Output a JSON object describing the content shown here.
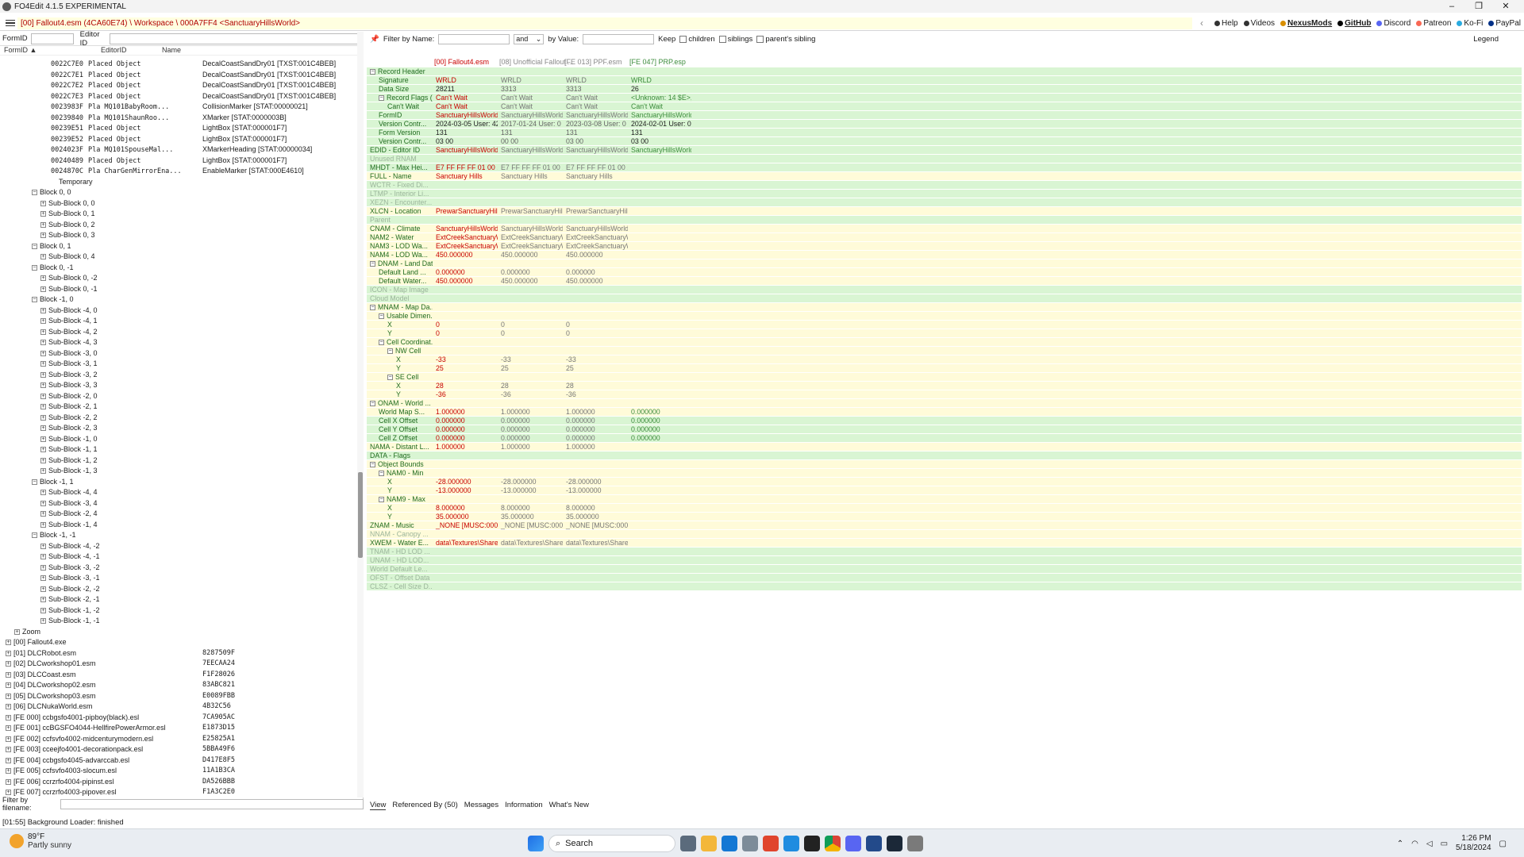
{
  "window": {
    "title": "FO4Edit 4.1.5 EXPERIMENTAL",
    "controls": [
      "–",
      "❐",
      "✕"
    ]
  },
  "menubar": {
    "path": "[00] Fallout4.esm (4CA60E74) \\ Workspace \\ 000A7FF4 <SanctuaryHillsWorld>",
    "back": "‹",
    "forward": "›",
    "links": [
      {
        "label": "Help",
        "color": "#333"
      },
      {
        "label": "Videos",
        "color": "#333"
      },
      {
        "label": "NexusMods",
        "color": "#d98f00",
        "bold": true
      },
      {
        "label": "GitHub",
        "color": "#000",
        "bold": true
      },
      {
        "label": "Discord",
        "color": "#5865f2"
      },
      {
        "label": "Patreon",
        "color": "#f96854"
      },
      {
        "label": "Ko-Fi",
        "color": "#29abe0"
      },
      {
        "label": "PayPal",
        "color": "#003087"
      }
    ]
  },
  "left": {
    "formid_label": "FormID",
    "editorid_label": "Editor ID",
    "col_formid": "FormID ▲",
    "col_editorid": "EditorID",
    "col_name": "Name",
    "filter_label": "Filter by filename:",
    "tree": [
      {
        "i": 64,
        "fid": "0022C7E0",
        "et": "Placed Object",
        "nm": "DecalCoastSandDry01 [TXST:001C4BEB]"
      },
      {
        "i": 64,
        "fid": "0022C7E1",
        "et": "Placed Object",
        "nm": "DecalCoastSandDry01 [TXST:001C4BEB]"
      },
      {
        "i": 64,
        "fid": "0022C7E2",
        "et": "Placed Object",
        "nm": "DecalCoastSandDry01 [TXST:001C4BEB]"
      },
      {
        "i": 64,
        "fid": "0022C7E3",
        "et": "Placed Object",
        "nm": "DecalCoastSandDry01 [TXST:001C4BEB]"
      },
      {
        "i": 64,
        "fid": "0023983F",
        "et": "Pla   MQ101BabyRoom...",
        "nm": "CollisionMarker [STAT:00000021]"
      },
      {
        "i": 64,
        "fid": "00239840",
        "et": "Pla   MQ101ShaunRoo...",
        "nm": "XMarker [STAT:0000003B]"
      },
      {
        "i": 64,
        "fid": "00239E51",
        "et": "Placed Object",
        "nm": "LightBox [STAT:000001F7]"
      },
      {
        "i": 64,
        "fid": "00239E52",
        "et": "Placed Object",
        "nm": "LightBox [STAT:000001F7]"
      },
      {
        "i": 64,
        "fid": "0024023F",
        "et": "Pla   MQ101SpouseMal...",
        "nm": "XMarkerHeading [STAT:00000034]"
      },
      {
        "i": 64,
        "fid": "00240489",
        "et": "Placed Object",
        "nm": "LightBox [STAT:000001F7]"
      },
      {
        "i": 64,
        "fid": "0024870C",
        "et": "Pla   CharGenMirrorEna...",
        "nm": "EnableMarker [STAT:000E4610]"
      },
      {
        "i": 64,
        "t": "Temporary"
      },
      {
        "i": 40,
        "t": "Block 0, 0",
        "e": "−"
      },
      {
        "i": 51,
        "t": "Sub-Block 0, 0",
        "e": "+"
      },
      {
        "i": 51,
        "t": "Sub-Block 0, 1",
        "e": "+"
      },
      {
        "i": 51,
        "t": "Sub-Block 0, 2",
        "e": "+"
      },
      {
        "i": 51,
        "t": "Sub-Block 0, 3",
        "e": "+"
      },
      {
        "i": 40,
        "t": "Block 0, 1",
        "e": "−"
      },
      {
        "i": 51,
        "t": "Sub-Block 0, 4",
        "e": "+"
      },
      {
        "i": 40,
        "t": "Block 0, -1",
        "e": "−"
      },
      {
        "i": 51,
        "t": "Sub-Block 0, -2",
        "e": "+"
      },
      {
        "i": 51,
        "t": "Sub-Block 0, -1",
        "e": "+"
      },
      {
        "i": 40,
        "t": "Block -1, 0",
        "e": "−"
      },
      {
        "i": 51,
        "t": "Sub-Block -4, 0",
        "e": "+"
      },
      {
        "i": 51,
        "t": "Sub-Block -4, 1",
        "e": "+"
      },
      {
        "i": 51,
        "t": "Sub-Block -4, 2",
        "e": "+"
      },
      {
        "i": 51,
        "t": "Sub-Block -4, 3",
        "e": "+"
      },
      {
        "i": 51,
        "t": "Sub-Block -3, 0",
        "e": "+"
      },
      {
        "i": 51,
        "t": "Sub-Block -3, 1",
        "e": "+"
      },
      {
        "i": 51,
        "t": "Sub-Block -3, 2",
        "e": "+"
      },
      {
        "i": 51,
        "t": "Sub-Block -3, 3",
        "e": "+"
      },
      {
        "i": 51,
        "t": "Sub-Block -2, 0",
        "e": "+"
      },
      {
        "i": 51,
        "t": "Sub-Block -2, 1",
        "e": "+"
      },
      {
        "i": 51,
        "t": "Sub-Block -2, 2",
        "e": "+"
      },
      {
        "i": 51,
        "t": "Sub-Block -2, 3",
        "e": "+"
      },
      {
        "i": 51,
        "t": "Sub-Block -1, 0",
        "e": "+"
      },
      {
        "i": 51,
        "t": "Sub-Block -1, 1",
        "e": "+"
      },
      {
        "i": 51,
        "t": "Sub-Block -1, 2",
        "e": "+"
      },
      {
        "i": 51,
        "t": "Sub-Block -1, 3",
        "e": "+"
      },
      {
        "i": 40,
        "t": "Block -1, 1",
        "e": "−"
      },
      {
        "i": 51,
        "t": "Sub-Block -4, 4",
        "e": "+"
      },
      {
        "i": 51,
        "t": "Sub-Block -3, 4",
        "e": "+"
      },
      {
        "i": 51,
        "t": "Sub-Block -2, 4",
        "e": "+"
      },
      {
        "i": 51,
        "t": "Sub-Block -1, 4",
        "e": "+"
      },
      {
        "i": 40,
        "t": "Block -1, -1",
        "e": "−"
      },
      {
        "i": 51,
        "t": "Sub-Block -4, -2",
        "e": "+"
      },
      {
        "i": 51,
        "t": "Sub-Block -4, -1",
        "e": "+"
      },
      {
        "i": 51,
        "t": "Sub-Block -3, -2",
        "e": "+"
      },
      {
        "i": 51,
        "t": "Sub-Block -3, -1",
        "e": "+"
      },
      {
        "i": 51,
        "t": "Sub-Block -2, -2",
        "e": "+"
      },
      {
        "i": 51,
        "t": "Sub-Block -2, -1",
        "e": "+"
      },
      {
        "i": 51,
        "t": "Sub-Block -1, -2",
        "e": "+"
      },
      {
        "i": 51,
        "t": "Sub-Block -1, -1",
        "e": "+"
      },
      {
        "i": 18,
        "t": "Zoom",
        "e": "+"
      },
      {
        "i": 7,
        "t": "[00] Fallout4.exe",
        "e": "+"
      },
      {
        "i": 7,
        "t": "[01] DLCRobot.esm",
        "e": "+",
        "hx": "8287509F"
      },
      {
        "i": 7,
        "t": "[02] DLCworkshop01.esm",
        "e": "+",
        "hx": "7EECAA24"
      },
      {
        "i": 7,
        "t": "[03] DLCCoast.esm",
        "e": "+",
        "hx": "F1F28026"
      },
      {
        "i": 7,
        "t": "[04] DLCworkshop02.esm",
        "e": "+",
        "hx": "83ABC821"
      },
      {
        "i": 7,
        "t": "[05] DLCworkshop03.esm",
        "e": "+",
        "hx": "E0089FBB"
      },
      {
        "i": 7,
        "t": "[06] DLCNukaWorld.esm",
        "e": "+",
        "hx": "4B32C56"
      },
      {
        "i": 7,
        "t": "[FE 000] ccbgsfo4001-pipboy(black).esl",
        "e": "+",
        "hx": "7CA905AC"
      },
      {
        "i": 7,
        "t": "[FE 001] ccBGSFO4044-HellfirePowerArmor.esl",
        "e": "+",
        "hx": "E1873D15"
      },
      {
        "i": 7,
        "t": "[FE 002] ccfsvfo4002-midcenturymodern.esl",
        "e": "+",
        "hx": "E25825A1"
      },
      {
        "i": 7,
        "t": "[FE 003] cceejfo4001-decorationpack.esl",
        "e": "+",
        "hx": "5BBA49F6"
      },
      {
        "i": 7,
        "t": "[FE 004] ccbgsfo4045-advarccab.esl",
        "e": "+",
        "hx": "D417E8F5"
      },
      {
        "i": 7,
        "t": "[FE 005] ccfsvfo4003-slocum.esl",
        "e": "+",
        "hx": "11A1B3CA"
      },
      {
        "i": 7,
        "t": "[FE 006] ccrzrfo4004-pipinst.esl",
        "e": "+",
        "hx": "DA526BBB"
      },
      {
        "i": 7,
        "t": "[FE 007] ccrzrfo4003-pipover.esl",
        "e": "+",
        "hx": "F1A3C2E0"
      }
    ]
  },
  "right": {
    "filter_name_label": "Filter by Name:",
    "and_label": "and",
    "by_value_label": "by Value:",
    "keep_label": "Keep",
    "children_label": "children",
    "siblings_label": "siblings",
    "parents_sibling_label": "parent's sibling",
    "legend_label": "Legend",
    "headers": [
      "[00] Fallout4.esm",
      "[08] Unofficial Fallout ...",
      "[FE 013] PPF.esm",
      "[FE 047] PRP.esp"
    ],
    "rows": [
      {
        "l": "Record Header",
        "ind": 0,
        "e": "−",
        "bg": "g",
        "v": []
      },
      {
        "l": "Signature",
        "ind": 1,
        "bg": "g",
        "v": [
          "WRLD",
          "WRLD",
          "WRLD",
          "WRLD"
        ]
      },
      {
        "l": "Data Size",
        "ind": 1,
        "bg": "g",
        "v": [
          "28211",
          "3313",
          "3313",
          "26"
        ],
        "k": [
          "#000",
          "#000",
          "#000",
          "#000"
        ]
      },
      {
        "l": "Record Flags (...",
        "ind": 1,
        "e": "−",
        "bg": "g",
        "v": [
          "Can't Wait",
          "Can't Wait",
          "Can't Wait",
          "<Unknown: 14 $E>, ..."
        ]
      },
      {
        "l": "Can't Wait",
        "ind": 2,
        "bg": "g",
        "v": [
          "Can't Wait",
          "Can't Wait",
          "Can't Wait",
          "Can't Wait"
        ]
      },
      {
        "l": "FormID",
        "ind": 1,
        "bg": "g",
        "v": [
          "SanctuaryHillsWorld ...",
          "SanctuaryHillsWorld ...",
          "SanctuaryHillsWorld ...",
          "SanctuaryHillsWorld ..."
        ]
      },
      {
        "l": "Version Contr...",
        "ind": 1,
        "bg": "g",
        "v": [
          "2024-03-05 User: 42...",
          "2017-01-24 User: 0 L...",
          "2023-03-08 User: 0 L...",
          "2024-02-01 User: 0 L..."
        ],
        "k": [
          "#000",
          "#000",
          "#000",
          "#000"
        ]
      },
      {
        "l": "Form Version",
        "ind": 1,
        "bg": "g",
        "v": [
          "131",
          "131",
          "131",
          "131"
        ],
        "k": [
          "#000",
          "#000",
          "#000",
          "#000"
        ]
      },
      {
        "l": "Version Contr...",
        "ind": 1,
        "bg": "g",
        "v": [
          "03 00",
          "00 00",
          "03 00",
          "03 00"
        ],
        "k": [
          "#000",
          "#000",
          "#000",
          "#000"
        ]
      },
      {
        "l": "EDID - Editor ID",
        "ind": 0,
        "bg": "g",
        "v": [
          "SanctuaryHillsWorld",
          "SanctuaryHillsWorld",
          "SanctuaryHillsWorld",
          "SanctuaryHillsWorld"
        ]
      },
      {
        "l": "Unused RNAM",
        "ind": 0,
        "bg": "g",
        "dim": true,
        "v": []
      },
      {
        "l": "MHDT - Max Hei...",
        "ind": 0,
        "bg": "g",
        "v": [
          "E7 FF FF FF 01 00 1A...",
          "E7 FF FF FF 01 00 1A...",
          "E7 FF FF FF 01 00 1A..."
        ]
      },
      {
        "l": "FULL - Name",
        "ind": 0,
        "bg": "y",
        "v": [
          "Sanctuary Hills",
          "Sanctuary Hills",
          "Sanctuary Hills"
        ]
      },
      {
        "l": "WCTR - Fixed Di...",
        "ind": 0,
        "bg": "g",
        "dim": true,
        "v": []
      },
      {
        "l": "LTMP - Interior Li...",
        "ind": 0,
        "bg": "g",
        "dim": true,
        "v": []
      },
      {
        "l": "XEZN - Encounter...",
        "ind": 0,
        "bg": "g",
        "dim": true,
        "v": []
      },
      {
        "l": "XLCN - Location",
        "ind": 0,
        "bg": "y",
        "v": [
          "PrewarSanctuaryHills...",
          "PrewarSanctuaryHills...",
          "PrewarSanctuaryHills..."
        ]
      },
      {
        "l": "Parent",
        "ind": 0,
        "bg": "g",
        "dim": true,
        "v": []
      },
      {
        "l": "CNAM - Climate",
        "ind": 0,
        "bg": "y",
        "v": [
          "SanctuaryHillsWorld...",
          "SanctuaryHillsWorld...",
          "SanctuaryHillsWorld..."
        ]
      },
      {
        "l": "NAM2 - Water",
        "ind": 0,
        "bg": "y",
        "v": [
          "ExtCreekSanctuaryW...",
          "ExtCreekSanctuaryW...",
          "ExtCreekSanctuaryW..."
        ]
      },
      {
        "l": "NAM3 - LOD Wa...",
        "ind": 0,
        "bg": "y",
        "v": [
          "ExtCreekSanctuaryW...",
          "ExtCreekSanctuaryW...",
          "ExtCreekSanctuaryW..."
        ]
      },
      {
        "l": "NAM4 - LOD Wa...",
        "ind": 0,
        "bg": "y",
        "v": [
          "450.000000",
          "450.000000",
          "450.000000"
        ]
      },
      {
        "l": "DNAM - Land Data",
        "ind": 0,
        "e": "−",
        "bg": "y",
        "v": []
      },
      {
        "l": "Default Land ...",
        "ind": 1,
        "bg": "y",
        "v": [
          "0.000000",
          "0.000000",
          "0.000000"
        ]
      },
      {
        "l": "Default Water...",
        "ind": 1,
        "bg": "y",
        "v": [
          "450.000000",
          "450.000000",
          "450.000000"
        ]
      },
      {
        "l": "ICON - Map Image",
        "ind": 0,
        "bg": "g",
        "dim": true,
        "v": []
      },
      {
        "l": "Cloud Model",
        "ind": 0,
        "bg": "g",
        "dim": true,
        "v": []
      },
      {
        "l": "MNAM - Map Da...",
        "ind": 0,
        "e": "−",
        "bg": "y",
        "v": []
      },
      {
        "l": "Usable Dimen...",
        "ind": 1,
        "e": "−",
        "bg": "y",
        "v": []
      },
      {
        "l": "X",
        "ind": 2,
        "bg": "y",
        "v": [
          "0",
          "0",
          "0"
        ]
      },
      {
        "l": "Y",
        "ind": 2,
        "bg": "y",
        "v": [
          "0",
          "0",
          "0"
        ]
      },
      {
        "l": "Cell Coordinat...",
        "ind": 1,
        "e": "−",
        "bg": "y",
        "v": []
      },
      {
        "l": "NW Cell",
        "ind": 2,
        "e": "−",
        "bg": "y",
        "v": []
      },
      {
        "l": "X",
        "ind": 3,
        "bg": "y",
        "v": [
          "-33",
          "-33",
          "-33"
        ]
      },
      {
        "l": "Y",
        "ind": 3,
        "bg": "y",
        "v": [
          "25",
          "25",
          "25"
        ]
      },
      {
        "l": "SE Cell",
        "ind": 2,
        "e": "−",
        "bg": "y",
        "v": []
      },
      {
        "l": "X",
        "ind": 3,
        "bg": "y",
        "v": [
          "28",
          "28",
          "28"
        ]
      },
      {
        "l": "Y",
        "ind": 3,
        "bg": "y",
        "v": [
          "-36",
          "-36",
          "-36"
        ]
      },
      {
        "l": "ONAM - World ...",
        "ind": 0,
        "e": "−",
        "bg": "y",
        "v": []
      },
      {
        "l": "World Map S...",
        "ind": 1,
        "bg": "y",
        "v": [
          "1.000000",
          "1.000000",
          "1.000000",
          "0.000000"
        ]
      },
      {
        "l": "Cell X Offset",
        "ind": 1,
        "bg": "g",
        "v": [
          "0.000000",
          "0.000000",
          "0.000000",
          "0.000000"
        ]
      },
      {
        "l": "Cell Y Offset",
        "ind": 1,
        "bg": "g",
        "v": [
          "0.000000",
          "0.000000",
          "0.000000",
          "0.000000"
        ]
      },
      {
        "l": "Cell Z Offset",
        "ind": 1,
        "bg": "g",
        "v": [
          "0.000000",
          "0.000000",
          "0.000000",
          "0.000000"
        ]
      },
      {
        "l": "NAMA - Distant L...",
        "ind": 0,
        "bg": "y",
        "v": [
          "1.000000",
          "1.000000",
          "1.000000"
        ]
      },
      {
        "l": "DATA - Flags",
        "ind": 0,
        "bg": "g",
        "v": []
      },
      {
        "l": "Object Bounds",
        "ind": 0,
        "e": "−",
        "bg": "y",
        "v": []
      },
      {
        "l": "NAM0 - Min",
        "ind": 1,
        "e": "−",
        "bg": "y",
        "v": []
      },
      {
        "l": "X",
        "ind": 2,
        "bg": "y",
        "v": [
          "-28.000000",
          "-28.000000",
          "-28.000000"
        ]
      },
      {
        "l": "Y",
        "ind": 2,
        "bg": "y",
        "v": [
          "-13.000000",
          "-13.000000",
          "-13.000000"
        ]
      },
      {
        "l": "NAM9 - Max",
        "ind": 1,
        "e": "−",
        "bg": "y",
        "v": []
      },
      {
        "l": "X",
        "ind": 2,
        "bg": "y",
        "v": [
          "8.000000",
          "8.000000",
          "8.000000"
        ]
      },
      {
        "l": "Y",
        "ind": 2,
        "bg": "y",
        "v": [
          "35.000000",
          "35.000000",
          "35.000000"
        ]
      },
      {
        "l": "ZNAM - Music",
        "ind": 0,
        "bg": "y",
        "v": [
          "_NONE [MUSC:0001...",
          "_NONE [MUSC:0001...",
          "_NONE [MUSC:0001..."
        ]
      },
      {
        "l": "NNAM - Canopy ...",
        "ind": 0,
        "bg": "y",
        "dim": true,
        "v": []
      },
      {
        "l": "XWEM - Water E...",
        "ind": 0,
        "bg": "y",
        "v": [
          "data\\Textures\\Share...",
          "data\\Textures\\Share...",
          "data\\Textures\\Share..."
        ]
      },
      {
        "l": "TNAM - HD LOD ...",
        "ind": 0,
        "bg": "g",
        "dim": true,
        "v": []
      },
      {
        "l": "UNAM - HD LOD...",
        "ind": 0,
        "bg": "g",
        "dim": true,
        "v": []
      },
      {
        "l": "World Default Le...",
        "ind": 0,
        "bg": "g",
        "dim": true,
        "v": []
      },
      {
        "l": "OFST - Offset Data",
        "ind": 0,
        "bg": "g",
        "dim": true,
        "v": []
      },
      {
        "l": "CLSZ - Cell Size D...",
        "ind": 0,
        "bg": "g",
        "dim": true,
        "v": []
      }
    ]
  },
  "bottomtabs": [
    "View",
    "Referenced By (50)",
    "Messages",
    "Information",
    "What's New"
  ],
  "status": "[01:55] Background Loader: finished",
  "taskbar": {
    "temp": "89°F",
    "cond": "Partly sunny",
    "search": "Search",
    "time": "1:26 PM",
    "date": "5/18/2024"
  },
  "colors": {
    "green": "#d9f5d3",
    "yellow": "#fffbd9",
    "red_text": "#c80000",
    "green_text": "#3c8c3c"
  }
}
